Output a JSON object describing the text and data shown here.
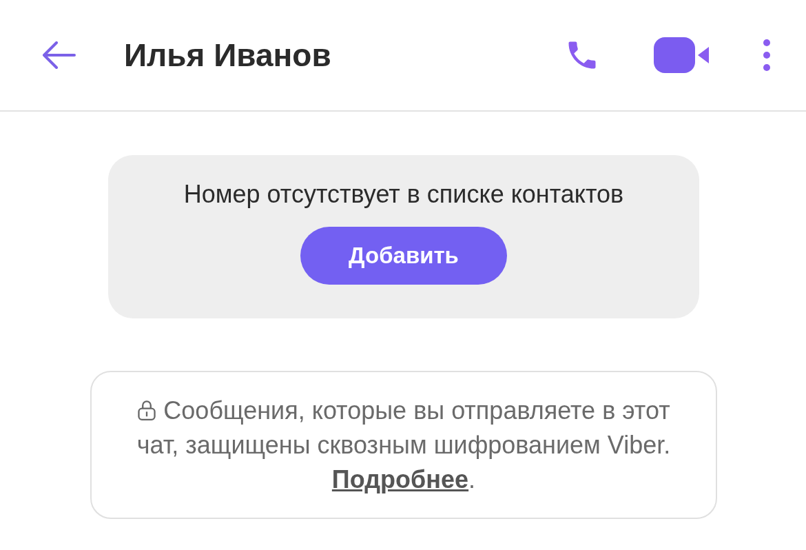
{
  "header": {
    "title": "Илья Иванов"
  },
  "contact_banner": {
    "message": "Номер отсутствует в списке контактов",
    "button": "Добавить"
  },
  "encryption_notice": {
    "text": "Сообщения, которые вы отправляете в этот чат, защищены сквозным шифрованием Viber.",
    "link": "Подробнее",
    "end": "."
  }
}
